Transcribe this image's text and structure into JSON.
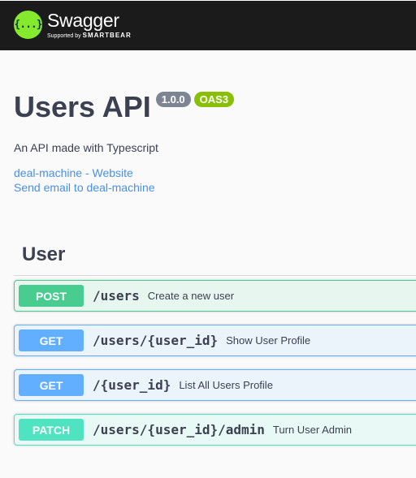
{
  "header": {
    "logo_glyph": "{...}",
    "logo_name": "Swagger",
    "logo_supported": "Supported by",
    "logo_brand": "SMARTBEAR"
  },
  "info": {
    "title": "Users API",
    "version": "1.0.0",
    "oas": "OAS3",
    "description": "An API made with Typescript",
    "website_link": "deal-machine - Website",
    "email_link": "Send email to deal-machine"
  },
  "tag": {
    "name": "User"
  },
  "operations": [
    {
      "method": "POST",
      "path": "/users",
      "summary": "Create a new user"
    },
    {
      "method": "GET",
      "path": "/users/{user_id}",
      "summary": "Show User Profile"
    },
    {
      "method": "GET",
      "path": "/{user_id}",
      "summary": "List All Users Profile"
    },
    {
      "method": "PATCH",
      "path": "/users/{user_id}/admin",
      "summary": "Turn User Admin"
    }
  ],
  "colors": {
    "topbar": "#1b1b1b",
    "logo_green": "#85ea2d",
    "post": "#49cc90",
    "get": "#61affe",
    "patch": "#50e3c2",
    "link": "#4990e2",
    "badge_version": "#7d8492",
    "badge_oas": "#89bf04"
  }
}
